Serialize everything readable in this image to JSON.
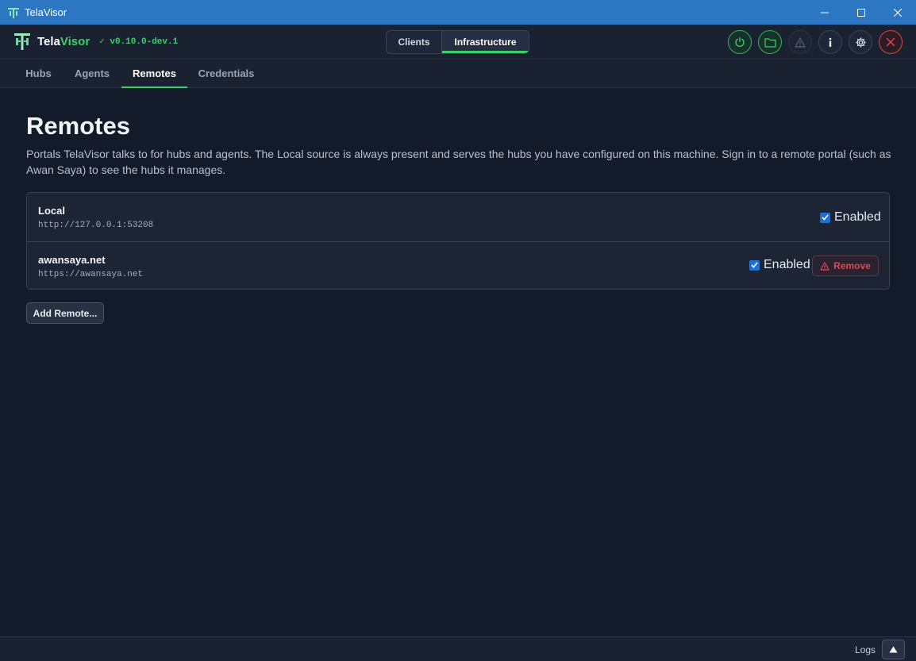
{
  "window": {
    "title": "TelaVisor",
    "controls": [
      "minimize-icon",
      "maximize-icon",
      "close-icon"
    ]
  },
  "header": {
    "brand_part1": "Tela",
    "brand_part2": "Visor",
    "version": "✓ v0.10.0-dev.1",
    "modes": [
      {
        "label": "Clients",
        "active": false
      },
      {
        "label": "Infrastructure",
        "active": true
      }
    ],
    "icons": [
      "power-icon",
      "folder-icon",
      "warning-icon",
      "info-icon",
      "gear-icon",
      "close-circle-icon"
    ]
  },
  "tabs": [
    {
      "label": "Hubs",
      "active": false
    },
    {
      "label": "Agents",
      "active": false
    },
    {
      "label": "Remotes",
      "active": true
    },
    {
      "label": "Credentials",
      "active": false
    }
  ],
  "main": {
    "title": "Remotes",
    "description": "Portals TelaVisor talks to for hubs and agents. The Local source is always present and serves the hubs you have configured on this machine. Sign in to a remote portal (such as Awan Saya) to see the hubs it manages.",
    "remotes": [
      {
        "name": "Local",
        "url": "http://127.0.0.1:53208",
        "enabled": true,
        "enabled_label": "Enabled"
      },
      {
        "name": "awansaya.net",
        "url": "https://awansaya.net",
        "enabled": true,
        "enabled_label": "Enabled",
        "remove_label": "Remove"
      }
    ],
    "add_button": "Add Remote..."
  },
  "footer": {
    "logs_label": "Logs"
  },
  "colors": {
    "accent_green": "#3ecf6a",
    "danger_red": "#e0474f",
    "titlebar_blue": "#2d76c2",
    "background": "#131a29"
  }
}
